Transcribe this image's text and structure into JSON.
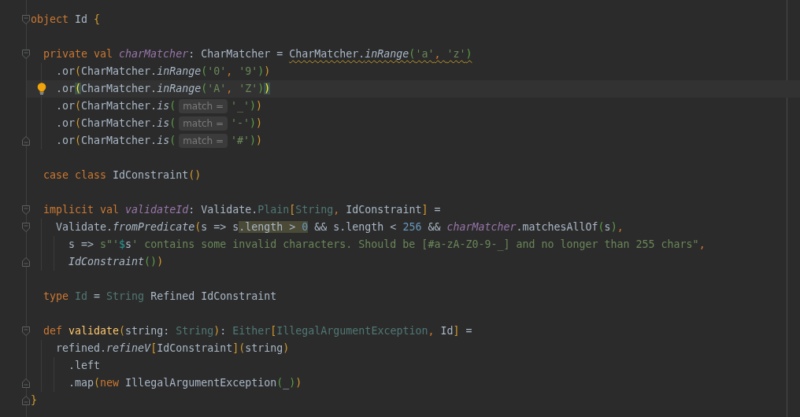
{
  "editor": {
    "lines": [
      {
        "fold_start": true,
        "tokens": [
          {
            "text": "object ",
            "kind": "keyword"
          },
          {
            "text": "Id ",
            "kind": "plain"
          },
          {
            "text": "{",
            "kind": "bracket1"
          }
        ]
      },
      {
        "blank_line_before": true,
        "fold_start": true,
        "tokens": [
          {
            "text": "  private val ",
            "kind": "keyword"
          },
          {
            "text": "charMatcher",
            "kind": "field"
          },
          {
            "text": ": CharMatcher = ",
            "kind": "plain"
          },
          {
            "text": "CharMatcher.",
            "kind": "plain",
            "warning": true
          },
          {
            "text": "inRange",
            "kind": "method",
            "warning": true
          },
          {
            "text": "(",
            "kind": "bracket2",
            "warning": true
          },
          {
            "text": "'a'",
            "kind": "string",
            "warning": true
          },
          {
            "text": ", ",
            "kind": "keyword",
            "warning": true
          },
          {
            "text": "'z'",
            "kind": "string",
            "warning": true
          },
          {
            "text": ")",
            "kind": "bracket2",
            "warning": true
          }
        ]
      },
      {
        "tokens": [
          {
            "text": "    .or",
            "kind": "plain"
          },
          {
            "text": "(",
            "kind": "bracket1"
          },
          {
            "text": "CharMatcher.",
            "kind": "plain"
          },
          {
            "text": "inRange",
            "kind": "method"
          },
          {
            "text": "(",
            "kind": "bracket2"
          },
          {
            "text": "'0'",
            "kind": "string"
          },
          {
            "text": ", ",
            "kind": "keyword"
          },
          {
            "text": "'9'",
            "kind": "string"
          },
          {
            "text": ")",
            "kind": "bracket2"
          },
          {
            "text": ")",
            "kind": "bracket1"
          }
        ]
      },
      {
        "current": true,
        "bulb": true,
        "tokens": [
          {
            "text": "    .or",
            "kind": "plain"
          },
          {
            "text": "(",
            "kind": "bracket1",
            "matched": true
          },
          {
            "text": "CharMatcher.",
            "kind": "plain"
          },
          {
            "text": "inRange",
            "kind": "method"
          },
          {
            "text": "(",
            "kind": "bracket2"
          },
          {
            "text": "'A'",
            "kind": "string"
          },
          {
            "text": ", ",
            "kind": "keyword"
          },
          {
            "text": "'Z'",
            "kind": "string"
          },
          {
            "text": ")",
            "kind": "bracket2"
          },
          {
            "text": ")",
            "kind": "bracket1",
            "matched": true
          }
        ]
      },
      {
        "tokens": [
          {
            "text": "    .or",
            "kind": "plain"
          },
          {
            "text": "(",
            "kind": "bracket1"
          },
          {
            "text": "CharMatcher.",
            "kind": "plain"
          },
          {
            "text": "is",
            "kind": "method"
          },
          {
            "text": "(",
            "kind": "bracket2"
          },
          {
            "text": "match =",
            "kind": "hint"
          },
          {
            "text": "'_'",
            "kind": "string"
          },
          {
            "text": ")",
            "kind": "bracket2"
          },
          {
            "text": ")",
            "kind": "bracket1"
          }
        ]
      },
      {
        "tokens": [
          {
            "text": "    .or",
            "kind": "plain"
          },
          {
            "text": "(",
            "kind": "bracket1"
          },
          {
            "text": "CharMatcher.",
            "kind": "plain"
          },
          {
            "text": "is",
            "kind": "method"
          },
          {
            "text": "(",
            "kind": "bracket2"
          },
          {
            "text": "match =",
            "kind": "hint"
          },
          {
            "text": "'-'",
            "kind": "string"
          },
          {
            "text": ")",
            "kind": "bracket2"
          },
          {
            "text": ")",
            "kind": "bracket1"
          }
        ]
      },
      {
        "fold_end": true,
        "tokens": [
          {
            "text": "    .or",
            "kind": "plain"
          },
          {
            "text": "(",
            "kind": "bracket1"
          },
          {
            "text": "CharMatcher.",
            "kind": "plain"
          },
          {
            "text": "is",
            "kind": "method"
          },
          {
            "text": "(",
            "kind": "bracket2"
          },
          {
            "text": "match =",
            "kind": "hint"
          },
          {
            "text": "'#'",
            "kind": "string"
          },
          {
            "text": ")",
            "kind": "bracket2"
          },
          {
            "text": ")",
            "kind": "bracket1"
          }
        ]
      },
      {
        "blank_line_before": true,
        "tokens": [
          {
            "text": "  case class ",
            "kind": "keyword"
          },
          {
            "text": "IdConstraint",
            "kind": "plain"
          },
          {
            "text": "()",
            "kind": "bracket1"
          }
        ]
      },
      {
        "blank_line_before": true,
        "fold_start": true,
        "tokens": [
          {
            "text": "  implicit val ",
            "kind": "keyword"
          },
          {
            "text": "validateId",
            "kind": "field"
          },
          {
            "text": ": Validate.",
            "kind": "plain"
          },
          {
            "text": "Plain",
            "kind": "type"
          },
          {
            "text": "[",
            "kind": "bracket1"
          },
          {
            "text": "String",
            "kind": "type"
          },
          {
            "text": ", ",
            "kind": "keyword"
          },
          {
            "text": "IdConstraint",
            "kind": "plain"
          },
          {
            "text": "]",
            "kind": "bracket1"
          },
          {
            "text": " =",
            "kind": "plain"
          }
        ]
      },
      {
        "fold_start": true,
        "tokens": [
          {
            "text": "    Validate.",
            "kind": "plain"
          },
          {
            "text": "fromPredicate",
            "kind": "method"
          },
          {
            "text": "(",
            "kind": "bracket1"
          },
          {
            "text": "s => s",
            "kind": "plain"
          },
          {
            "text": ".length > ",
            "kind": "plain",
            "highlighted": true
          },
          {
            "text": "0",
            "kind": "number",
            "highlighted": true
          },
          {
            "text": " && s.length < ",
            "kind": "plain"
          },
          {
            "text": "256",
            "kind": "number"
          },
          {
            "text": " && ",
            "kind": "plain"
          },
          {
            "text": "charMatcher",
            "kind": "field"
          },
          {
            "text": ".matchesAllOf",
            "kind": "plain"
          },
          {
            "text": "(",
            "kind": "bracket2"
          },
          {
            "text": "s",
            "kind": "plain"
          },
          {
            "text": ")",
            "kind": "bracket2"
          },
          {
            "text": ",",
            "kind": "keyword"
          }
        ]
      },
      {
        "tokens": [
          {
            "text": "      s => ",
            "kind": "plain"
          },
          {
            "text": "s\"'",
            "kind": "string"
          },
          {
            "text": "$",
            "kind": "interp"
          },
          {
            "text": "s",
            "kind": "plain"
          },
          {
            "text": "' contains some invalid characters. Should be [#a-zA-Z0-9-_] and no longer than 255 chars\"",
            "kind": "string"
          },
          {
            "text": ",",
            "kind": "keyword"
          }
        ]
      },
      {
        "fold_end": true,
        "tokens": [
          {
            "text": "      IdConstraint",
            "kind": "method"
          },
          {
            "text": "()",
            "kind": "bracket2"
          },
          {
            "text": ")",
            "kind": "bracket1"
          }
        ]
      },
      {
        "blank_line_before": true,
        "tokens": [
          {
            "text": "  type ",
            "kind": "keyword"
          },
          {
            "text": "Id",
            "kind": "type"
          },
          {
            "text": " = ",
            "kind": "plain"
          },
          {
            "text": "String",
            "kind": "type"
          },
          {
            "text": " Refined IdConstraint",
            "kind": "plain"
          }
        ]
      },
      {
        "blank_line_before": true,
        "fold_start": true,
        "tokens": [
          {
            "text": "  def ",
            "kind": "keyword"
          },
          {
            "text": "validate",
            "kind": "decl"
          },
          {
            "text": "(",
            "kind": "bracket1"
          },
          {
            "text": "string: ",
            "kind": "plain"
          },
          {
            "text": "String",
            "kind": "type"
          },
          {
            "text": ")",
            "kind": "bracket1"
          },
          {
            "text": ": ",
            "kind": "plain"
          },
          {
            "text": "Either",
            "kind": "type"
          },
          {
            "text": "[",
            "kind": "bracket1"
          },
          {
            "text": "IllegalArgumentException",
            "kind": "type"
          },
          {
            "text": ", ",
            "kind": "keyword"
          },
          {
            "text": "Id",
            "kind": "plain"
          },
          {
            "text": "]",
            "kind": "bracket1"
          },
          {
            "text": " =",
            "kind": "plain"
          }
        ]
      },
      {
        "tokens": [
          {
            "text": "    refined.",
            "kind": "plain"
          },
          {
            "text": "refineV",
            "kind": "method"
          },
          {
            "text": "[",
            "kind": "bracket1"
          },
          {
            "text": "IdConstraint",
            "kind": "plain"
          },
          {
            "text": "]",
            "kind": "bracket1"
          },
          {
            "text": "(",
            "kind": "bracket1"
          },
          {
            "text": "string",
            "kind": "plain"
          },
          {
            "text": ")",
            "kind": "bracket1"
          }
        ]
      },
      {
        "tokens": [
          {
            "text": "      .left",
            "kind": "plain"
          }
        ]
      },
      {
        "fold_end": true,
        "tokens": [
          {
            "text": "      .map",
            "kind": "plain"
          },
          {
            "text": "(",
            "kind": "bracket1"
          },
          {
            "text": "new ",
            "kind": "keyword"
          },
          {
            "text": "IllegalArgumentException",
            "kind": "plain"
          },
          {
            "text": "(",
            "kind": "bracket2"
          },
          {
            "text": "_",
            "kind": "plain"
          },
          {
            "text": ")",
            "kind": "bracket2"
          },
          {
            "text": ")",
            "kind": "bracket1"
          }
        ]
      },
      {
        "fold_end": true,
        "tokens": [
          {
            "text": "}",
            "kind": "bracket1"
          }
        ]
      }
    ]
  }
}
